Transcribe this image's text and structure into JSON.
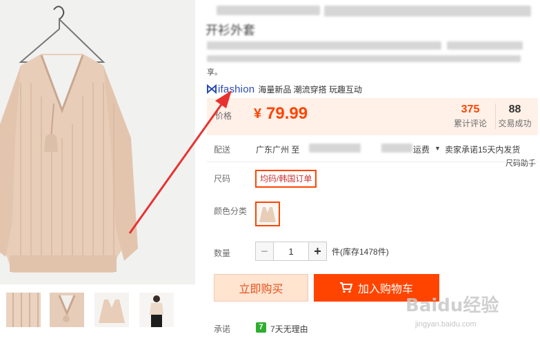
{
  "title": {
    "visible_fragment": "开衫外套",
    "description_end": "享。"
  },
  "ifashion": {
    "logo_text": "ifashion",
    "tagline": "海量新品 潮流穿搭 玩趣互动"
  },
  "price": {
    "label": "价格",
    "currency": "¥",
    "value": "79.99"
  },
  "stats": {
    "reviews_count": "375",
    "reviews_label": "累计评论",
    "sales_count": "88",
    "sales_label": "交易成功"
  },
  "shipping": {
    "label": "配送",
    "origin": "广东广州 至",
    "fee_label": "运费",
    "promise": "卖家承诺15天内发货",
    "size_helper": "尺码助手"
  },
  "size": {
    "label": "尺码",
    "selected": "均码/韩国订单"
  },
  "color": {
    "label": "颜色分类"
  },
  "quantity": {
    "label": "数量",
    "value": "1",
    "minus": "−",
    "plus": "+",
    "stock": "件(库存1478件)"
  },
  "actions": {
    "buy_now": "立即购买",
    "add_to_cart": "加入购物车"
  },
  "promise": {
    "label": "承诺",
    "badge": "7",
    "text": "7天无理由"
  },
  "watermark": {
    "brand": "Baidu经验",
    "url": "jingyan.baidu.com"
  },
  "colors": {
    "accent": "#ff4400",
    "price_band": "#fff0e8",
    "sweater": "#e8cdb8",
    "ifashion_blue": "#2a4bb0"
  }
}
